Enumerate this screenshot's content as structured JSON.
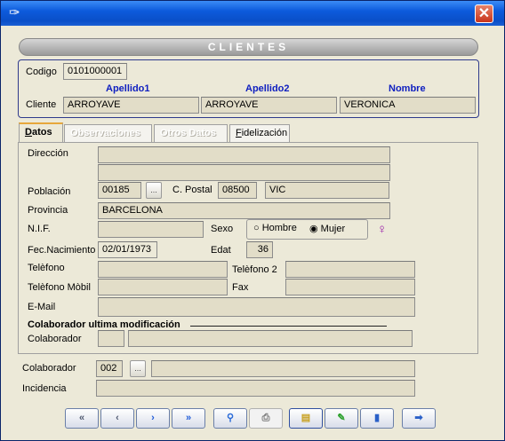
{
  "window": {
    "icon": "wrench-icon",
    "close": "✕"
  },
  "header": {
    "title": "CLIENTES"
  },
  "top": {
    "codigo_label": "Codigo",
    "codigo_value": "0101000001",
    "apellido1_header": "Apellido1",
    "apellido2_header": "Apellido2",
    "nombre_header": "Nombre",
    "cliente_label": "Cliente",
    "apellido1": "ARROYAVE",
    "apellido2": "ARROYAVE",
    "nombre": "VERONICA"
  },
  "tabs": [
    {
      "label": "Datos",
      "first": "D",
      "rest": "atos"
    },
    {
      "label": "Observaciones"
    },
    {
      "label": "Otros Datos"
    },
    {
      "label": "Fidelización",
      "first": "F",
      "rest": "idelización"
    }
  ],
  "datos": {
    "direccion_label": "Dirección",
    "direccion1": "",
    "direccion2": "",
    "poblacion_label": "Población",
    "poblacion_code": "00185",
    "ellipsis": "...",
    "cpostal_label": "C. Postal",
    "cpostal": "08500",
    "ciudad": "VIC",
    "provincia_label": "Provincia",
    "provincia": "BARCELONA",
    "nif_label": "N.I.F.",
    "nif": "",
    "sexo_label": "Sexo",
    "hombre": "Hombre",
    "mujer": "Mujer",
    "fecnac_label": "Fec.Nacimiento",
    "fecnac": "02/01/1973",
    "edat_label": "Edat",
    "edat": "36",
    "telefono_label": "Telèfono",
    "telefono2_label": "Telèfono 2",
    "movil_label": "Telèfono Mòbil",
    "fax_label": "Fax",
    "email_label": "E-Mail",
    "colab_section": "Colaborador ultima modificación",
    "colab_label": "Colaborador"
  },
  "bottom": {
    "colab_label": "Colaborador",
    "colab_code": "002",
    "incidencia_label": "Incidencia"
  },
  "toolbar": [
    "first-record-icon",
    "prev-record-icon",
    "next-record-icon",
    "last-record-icon",
    "search-icon",
    "print-icon",
    "notes-icon",
    "edit-pencil-icon",
    "delete-icon",
    "exit-icon"
  ]
}
